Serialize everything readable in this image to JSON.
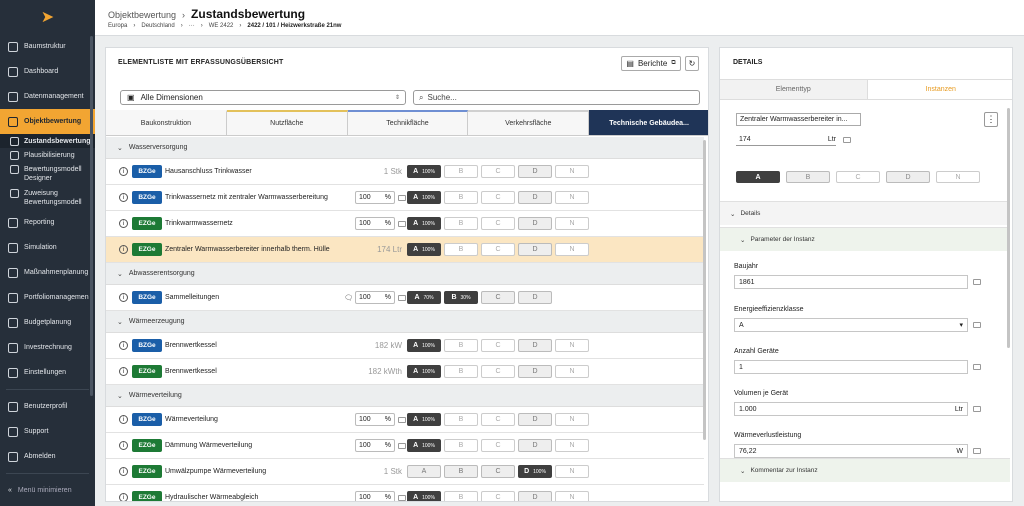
{
  "sidebar": {
    "items": [
      {
        "label": "Baumstruktur",
        "icon": "tree-icon"
      },
      {
        "label": "Dashboard",
        "icon": "gauge-icon"
      },
      {
        "label": "Datenmanagement",
        "icon": "database-icon"
      },
      {
        "label": "Objektbewertung",
        "icon": "clipboard-icon",
        "active": true
      }
    ],
    "sub_items": [
      {
        "label": "Zustandsbewertung",
        "current": true
      },
      {
        "label": "Plausibilisierung"
      },
      {
        "label": "Bewertungsmodell Designer"
      },
      {
        "label": "Zuweisung Bewertungsmodell"
      }
    ],
    "items2": [
      {
        "label": "Reporting",
        "icon": "report-icon"
      },
      {
        "label": "Simulation",
        "icon": "chart-icon"
      },
      {
        "label": "Maßnahmenplanung",
        "icon": "wrench-icon"
      },
      {
        "label": "Portfoliomanagemen",
        "icon": "portfolio-icon"
      },
      {
        "label": "Budgetplanung",
        "icon": "budget-icon"
      },
      {
        "label": "Investrechnung",
        "icon": "calculator-icon"
      },
      {
        "label": "Einstellungen",
        "icon": "gear-icon"
      }
    ],
    "items3": [
      {
        "label": "Benutzerprofil",
        "icon": "user-icon"
      },
      {
        "label": "Support",
        "icon": "help-icon"
      },
      {
        "label": "Abmelden",
        "icon": "logout-icon"
      }
    ],
    "minimize": "Menü minimieren"
  },
  "header": {
    "crumb_parent": "Objektbewertung",
    "title": "Zustandsbewertung",
    "crumbs": [
      "Europa",
      "Deutschland",
      "···",
      "WE 2422"
    ],
    "crumb_current": "2422 / 101 / Heizwerkstraße 21nw"
  },
  "main": {
    "title": "ELEMENTLISTE MIT ERFASSUNGSÜBERSICHT",
    "berichte": "Berichte",
    "dimension": "Alle Dimensionen",
    "search_placeholder": "Suche...",
    "tabs": [
      "Baukonstruktion",
      "Nutzfläche",
      "Technikfläche",
      "Verkehrsfläche",
      "Technische Gebäudea..."
    ]
  },
  "groups": [
    {
      "label": "Wasserversorgung",
      "rows": [
        {
          "type": "BZGe",
          "name": "Hausanschluss Trinkwasser",
          "qty": "1 Stk",
          "grades": [
            "A 100%",
            "B",
            "C",
            "D",
            "N"
          ],
          "sel": [
            0
          ],
          "mid": [
            3
          ]
        },
        {
          "type": "BZGe",
          "name": "Trinkwassernetz mit zentraler Warmwasserbereitung",
          "pct": "100",
          "grades": [
            "A 100%",
            "B",
            "C",
            "D",
            "N"
          ],
          "sel": [
            0
          ],
          "mid": [
            3
          ]
        },
        {
          "type": "EZGe",
          "name": "Trinkwarmwassernetz",
          "pct": "100",
          "grades": [
            "A 100%",
            "B",
            "C",
            "D",
            "N"
          ],
          "sel": [
            0
          ],
          "mid": [
            3
          ]
        },
        {
          "type": "EZGe",
          "name": "Zentraler Warmwasserbereiter innerhalb therm. Hülle",
          "qty": "174 Ltr",
          "grades": [
            "A 100%",
            "B",
            "C",
            "D",
            "N"
          ],
          "sel": [
            0
          ],
          "mid": [
            3
          ],
          "highlight": true
        }
      ]
    },
    {
      "label": "Abwasserentsorgung",
      "rows": [
        {
          "type": "BZGe",
          "name": "Sammelleitungen",
          "pct": "100",
          "comment": true,
          "grades": [
            "A 70%",
            "B 30%",
            "C",
            "D"
          ],
          "sel": [
            0,
            1
          ],
          "mid": [
            2,
            3
          ]
        }
      ]
    },
    {
      "label": "Wärmeerzeugung",
      "rows": [
        {
          "type": "BZGe",
          "name": "Brennwertkessel",
          "qty": "182 kW",
          "grades": [
            "A 100%",
            "B",
            "C",
            "D",
            "N"
          ],
          "sel": [
            0
          ],
          "mid": [
            3
          ]
        },
        {
          "type": "EZGe",
          "name": "Brennwertkessel",
          "qty": "182 kWth",
          "grades": [
            "A 100%",
            "B",
            "C",
            "D",
            "N"
          ],
          "sel": [
            0
          ],
          "mid": [
            3
          ]
        }
      ]
    },
    {
      "label": "Wärmeverteilung",
      "rows": [
        {
          "type": "BZGe",
          "name": "Wärmeverteilung",
          "pct": "100",
          "grades": [
            "A 100%",
            "B",
            "C",
            "D",
            "N"
          ],
          "sel": [
            0
          ],
          "mid": [
            3
          ]
        },
        {
          "type": "EZGe",
          "name": "Dämmung Wärmeverteilung",
          "pct": "100",
          "grades": [
            "A 100%",
            "B",
            "C",
            "D",
            "N"
          ],
          "sel": [
            0
          ],
          "mid": [
            3
          ]
        },
        {
          "type": "EZGe",
          "name": "Umwälzpumpe Wärmeverteilung",
          "qty": "1 Stk",
          "grades": [
            "A",
            "B",
            "C",
            "D 100%",
            "N"
          ],
          "sel": [
            3
          ],
          "mid": [
            0,
            1,
            2
          ]
        },
        {
          "type": "EZGe",
          "name": "Hydraulischer Wärmeabgleich",
          "pct": "100",
          "grades": [
            "A 100%",
            "B",
            "C",
            "D",
            "N"
          ],
          "sel": [
            0
          ],
          "mid": [
            3
          ]
        }
      ]
    }
  ],
  "details": {
    "title": "DETAILS",
    "tabs": [
      "Elementtyp",
      "Instanzen"
    ],
    "element": "Zentraler Warmwasserbereiter in...",
    "qty": "174",
    "qty_unit": "Ltr",
    "grades": [
      "A",
      "B",
      "C",
      "D",
      "N"
    ],
    "section1": "Details",
    "section2": "Parameter der Instanz",
    "fields": [
      {
        "label": "Baujahr",
        "value": "1861",
        "unit": ""
      },
      {
        "label": "Energieeffizienzklasse",
        "value": "A",
        "unit": "▾"
      },
      {
        "label": "Anzahl Geräte",
        "value": "1",
        "unit": ""
      },
      {
        "label": "Volumen je Gerät",
        "value": "1.000",
        "unit": "Ltr"
      },
      {
        "label": "Wärmeverlustleistung",
        "value": "76,22",
        "unit": "W"
      }
    ],
    "section3": "Kommentar zur Instanz"
  },
  "colors": {
    "accent": "#f2a532",
    "sidebar": "#262f3a",
    "tab_selected": "#1f3457",
    "bz": "#1a5ea8",
    "ez": "#1d7a35",
    "highlight": "#fbe6c2"
  }
}
